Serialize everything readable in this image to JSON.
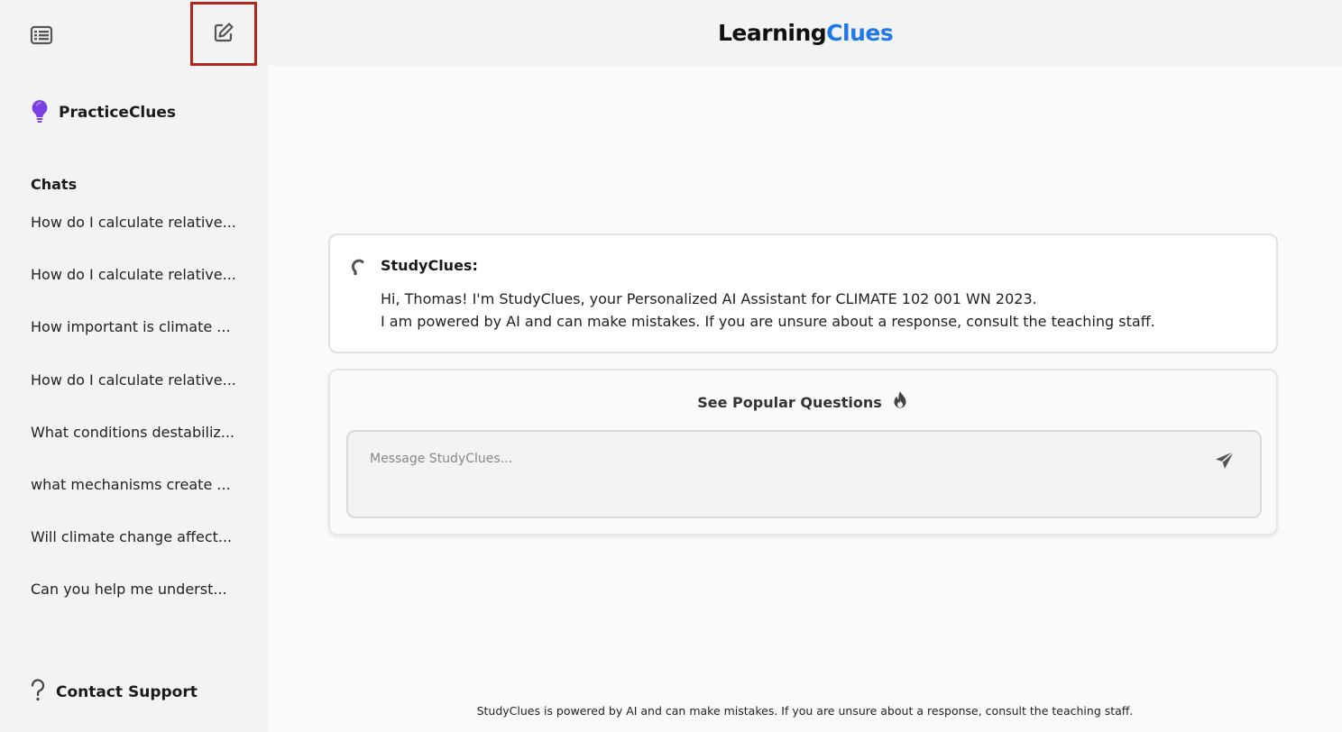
{
  "sidebar": {
    "practice_label": "PracticeClues",
    "chats_heading": "Chats",
    "chats": [
      "How do I calculate relative...",
      "How do I calculate relative...",
      "How important is climate ...",
      "How do I calculate relative...",
      "What conditions destabiliz...",
      "what mechanisms create ...",
      "Will climate change affect...",
      "Can you help me underst..."
    ],
    "support_label": "Contact Support"
  },
  "header": {
    "logo_part1": "Learning",
    "logo_part2": "Clues"
  },
  "message": {
    "sender": "StudyClues:",
    "line1": "Hi, Thomas! I'm StudyClues, your Personalized AI Assistant for CLIMATE 102 001 WN 2023.",
    "line2": "I am powered by AI and can make mistakes. If you are unsure about a response, consult the teaching staff."
  },
  "composer": {
    "popular_label": "See Popular Questions",
    "placeholder": "Message StudyClues..."
  },
  "footer": {
    "note": "StudyClues is powered by AI and can make mistakes. If you are unsure about a response, consult the teaching staff."
  },
  "colors": {
    "accent": "#1f7ae8",
    "highlight_border": "#b2261d",
    "bulb": "#7b3fe4"
  }
}
